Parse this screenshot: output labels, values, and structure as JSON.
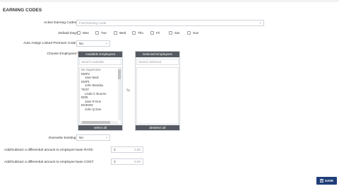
{
  "page": {
    "title": "EARNING CODES"
  },
  "form": {
    "active_earning_codes_label": "Active Earning Codes",
    "required_mark": "*",
    "find_placeholder": "Find Earning Code",
    "default_days_label": "Default Days",
    "days": [
      "Mon",
      "Tue",
      "Wed",
      "Thu",
      "Fri",
      "Sat",
      "Sun"
    ],
    "auto_assign_label": "Auto Assign Linked Premium Code?",
    "auto_assign_value": "No",
    "choose_employees_label": "Choose Employees",
    "available": {
      "header": "Available Employees",
      "search_placeholder": "Search Available",
      "items": [
        {
          "text": "No Supervisor",
          "sub": false
        },
        {
          "text": "EMP2",
          "sub": false
        },
        {
          "text": "Jane Beal",
          "sub": true
        },
        {
          "text": "EMP1",
          "sub": false
        },
        {
          "text": "John Beasley",
          "sub": true
        },
        {
          "text": "TEST",
          "sub": false
        },
        {
          "text": "Linda C Bourne",
          "sub": true
        },
        {
          "text": "BOB",
          "sub": false
        },
        {
          "text": "Jane R Doe",
          "sub": true
        },
        {
          "text": "DOE002",
          "sub": false
        },
        {
          "text": "John Q Doe",
          "sub": true
        }
      ],
      "footer": "select all"
    },
    "selected": {
      "header": "Selected Employees",
      "search_placeholder": "Search Selected",
      "footer": "deselect all"
    },
    "overwrite_label": "Overwrite Existing?",
    "overwrite_value": "No",
    "rate_label": "Add/Subtract a differential amount to employee base RATE:",
    "rate_currency": "$",
    "rate_value": "0.00",
    "cost_label": "Add/Subtract a differential amount to employee base COST:",
    "cost_currency": "$",
    "cost_value": "0.00",
    "save_label": "SAVE"
  },
  "colors": {
    "panel_header": "#555b61",
    "save_button": "#1f3d78"
  }
}
